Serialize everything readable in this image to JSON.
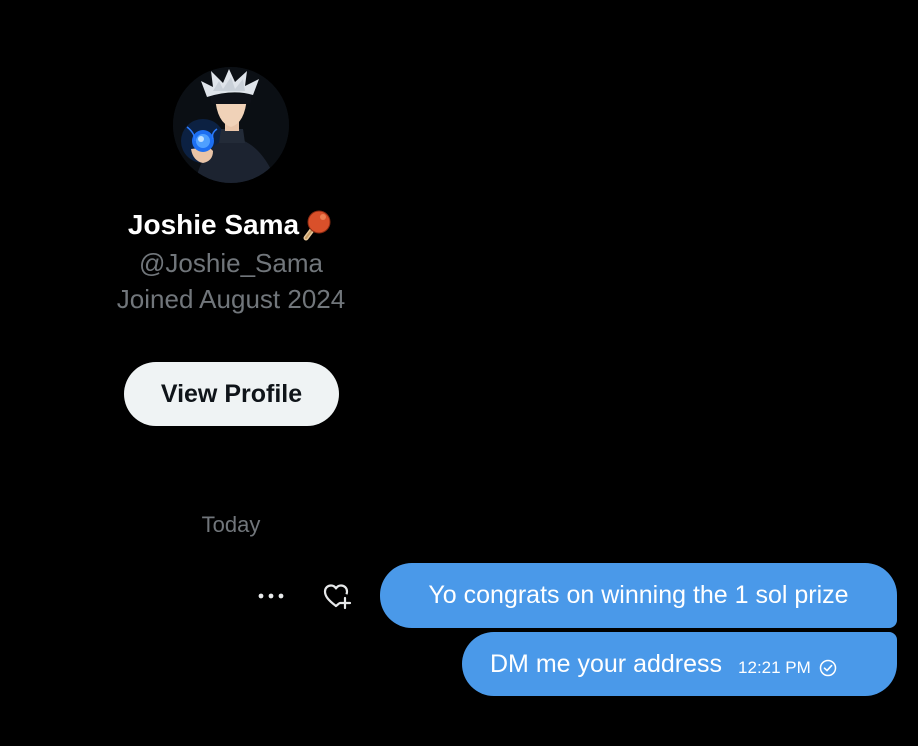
{
  "profile": {
    "display_name": "Joshie Sama",
    "name_emoji": "ping-pong-paddle-emoji",
    "handle": "@Joshie_Sama",
    "joined": "Joined August 2024",
    "view_profile_label": "View Profile"
  },
  "conversation": {
    "date_divider": "Today",
    "messages": [
      {
        "text": "Yo congrats on winning the 1 sol prize"
      },
      {
        "text": "DM me your address",
        "time": "12:21 PM",
        "status_icon": "sent-check-icon"
      }
    ],
    "actions": {
      "more_icon": "more-horizontal-icon",
      "react_icon": "add-reaction-heart-icon"
    }
  },
  "colors": {
    "background": "#000000",
    "bubble": "#4a99e9",
    "muted_text": "#71767b",
    "button_bg": "#eff3f4"
  }
}
